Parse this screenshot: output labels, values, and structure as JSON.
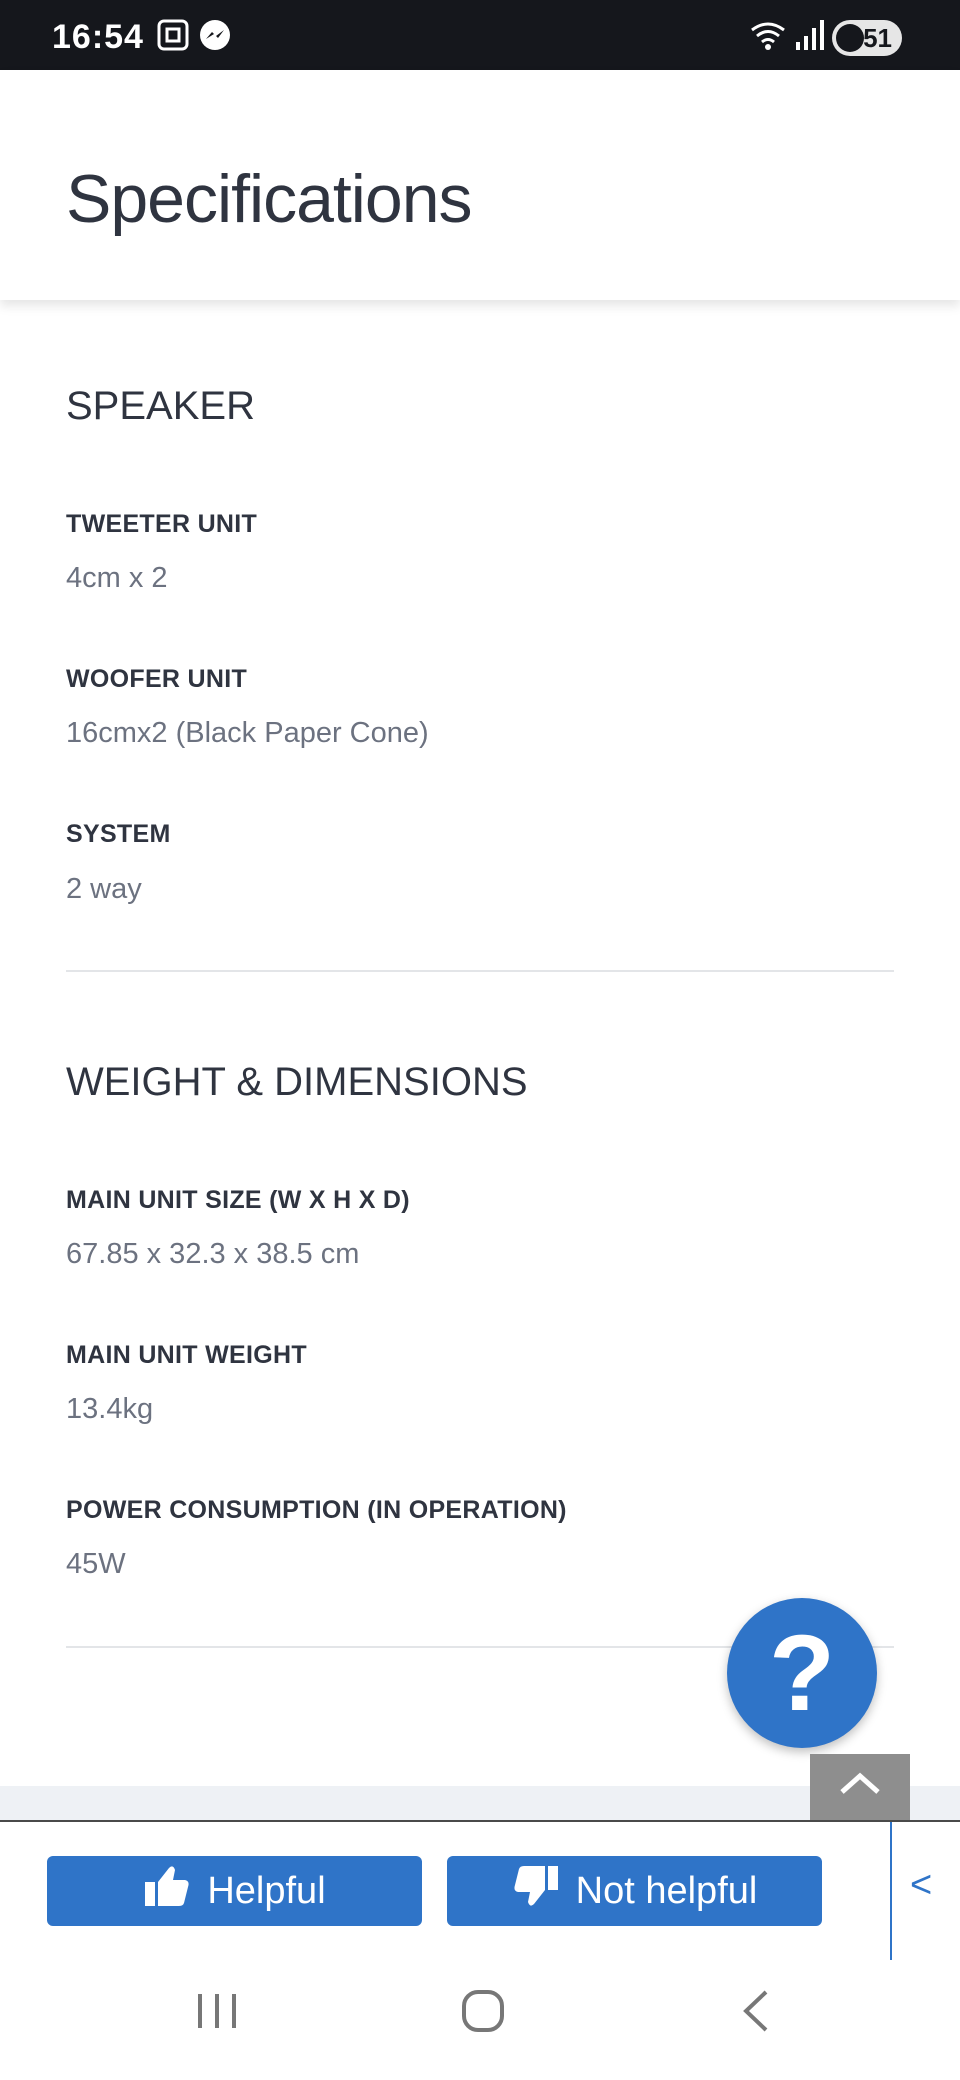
{
  "status_bar": {
    "time": "16:54",
    "battery": "51"
  },
  "page": {
    "title": "Specifications"
  },
  "sections": [
    {
      "title": "SPEAKER",
      "specs": [
        {
          "label": "TWEETER UNIT",
          "value": "4cm x 2"
        },
        {
          "label": "WOOFER UNIT",
          "value": "16cmx2 (Black Paper Cone)"
        },
        {
          "label": "SYSTEM",
          "value": "2 way"
        }
      ]
    },
    {
      "title": "WEIGHT & DIMENSIONS",
      "specs": [
        {
          "label": "MAIN UNIT SIZE (W X H X D)",
          "value": "67.85 x 32.3 x 38.5 cm"
        },
        {
          "label": "MAIN UNIT WEIGHT",
          "value": "13.4kg"
        },
        {
          "label": "POWER CONSUMPTION (IN OPERATION)",
          "value": "45W"
        }
      ]
    }
  ],
  "help_fab": {
    "symbol": "?"
  },
  "feedback": {
    "helpful_label": "Helpful",
    "not_helpful_label": "Not helpful",
    "side_arrow": "<"
  },
  "colors": {
    "accent": "#2f74c8",
    "status_bar_bg": "#15171c",
    "scroll_top_bg": "#8e8e8e"
  },
  "icons": {
    "status": [
      "screenshot-icon",
      "messenger-icon",
      "wifi-icon",
      "signal-icon",
      "battery-icon"
    ],
    "nav": [
      "recents-icon",
      "home-icon",
      "back-icon"
    ]
  }
}
